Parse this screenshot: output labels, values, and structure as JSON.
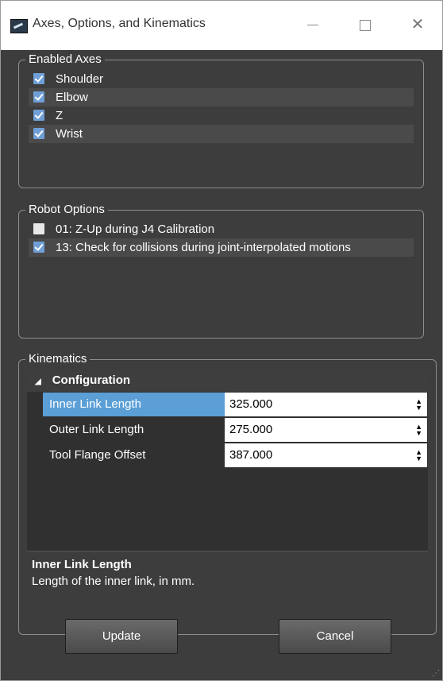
{
  "window": {
    "title": "Axes, Options, and Kinematics",
    "min_icon": "minimize-icon",
    "max_icon": "maximize-icon",
    "close_glyph": "✕"
  },
  "enabled_axes": {
    "label": "Enabled Axes",
    "items": [
      {
        "label": "Shoulder",
        "checked": true
      },
      {
        "label": "Elbow",
        "checked": true
      },
      {
        "label": "Z",
        "checked": true
      },
      {
        "label": "Wrist",
        "checked": true
      }
    ]
  },
  "robot_options": {
    "label": "Robot Options",
    "items": [
      {
        "label": "01: Z-Up during J4 Calibration",
        "checked": false
      },
      {
        "label": "13: Check for collisions during joint-interpolated motions",
        "checked": true
      }
    ]
  },
  "kinematics": {
    "label": "Kinematics",
    "section": "Configuration",
    "properties": [
      {
        "name": "Inner Link Length",
        "value": "325.000",
        "selected": true
      },
      {
        "name": "Outer Link Length",
        "value": "275.000",
        "selected": false
      },
      {
        "name": "Tool Flange Offset",
        "value": "387.000",
        "selected": false
      }
    ],
    "description_title": "Inner Link Length",
    "description_text": "Length of the inner link, in mm."
  },
  "buttons": {
    "update": "Update",
    "cancel": "Cancel"
  },
  "colors": {
    "background": "#3d3d3d",
    "selection": "#5b9fd6",
    "checkbox_checked": "#6f9fd6"
  }
}
